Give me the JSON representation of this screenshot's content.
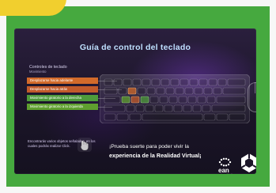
{
  "screen": {
    "title": "Guía de control del teclado",
    "controls_title": "Controles de teclado",
    "controls_subtitle": "Movimiento",
    "rows": [
      {
        "label": "Desplazarse hacia adelante"
      },
      {
        "label": "Desplazarse hacia atrás"
      },
      {
        "label": "Movimiento giratorio a la derecha"
      },
      {
        "label": "Movimiento giratorio a la izquierda"
      }
    ],
    "hint": "Encontrarás varios objetos señalados, en los cuales podrás realizar Click.",
    "message_line1": "¡Prueba suerte para poder vivir la",
    "message_line2": "experiencia de la Realidad Virtual¡",
    "logo_ean": "ean",
    "logo_ean_sub": "universidad"
  },
  "colors": {
    "frame_green": "#46a93f",
    "tab_yellow": "#f1cf2e",
    "title_cyan": "#bfe0ff",
    "row_orange": "#d26a2a",
    "row_green": "#4e9b3b"
  },
  "icons": [
    "hand-pointer-icon",
    "keyboard-icon",
    "mouse-icon",
    "ean-logo-icon",
    "unity-logo-icon"
  ]
}
